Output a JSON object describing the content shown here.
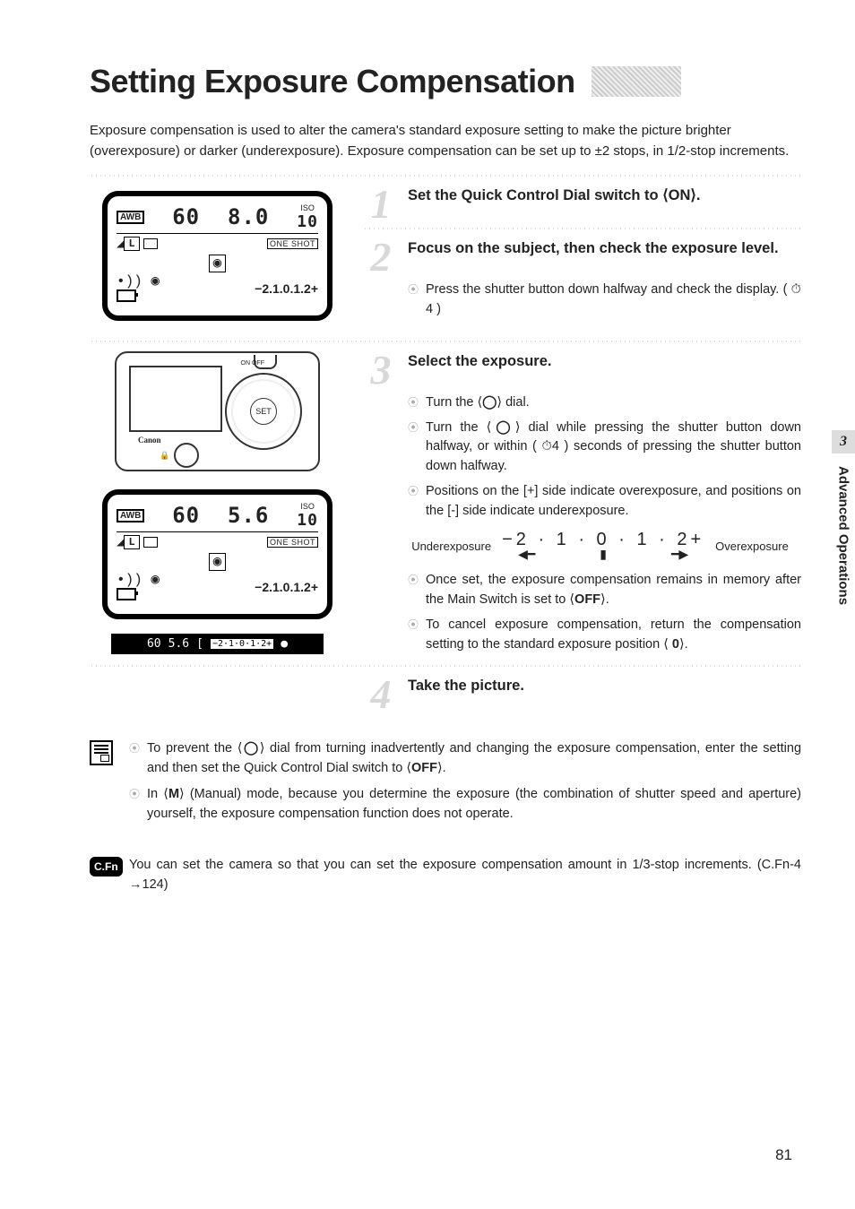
{
  "title": "Setting Exposure Compensation",
  "intro": "Exposure compensation is used to alter the camera's standard exposure setting to make the picture brighter (overexposure) or darker (underexposure). Exposure compensation can be set up to ±2 stops, in 1/2-stop increments.",
  "side_tab": {
    "num": "3",
    "label": "Advanced Operations"
  },
  "page_number": "81",
  "lcd1": {
    "awb": "AWB",
    "shutter": "60",
    "aperture": "8.0",
    "iso_lbl": "ISO",
    "iso": "10",
    "one_shot": "ONE SHOT",
    "l": "L",
    "circ": "◉",
    "scale": "−2.1.0.1.2+"
  },
  "lcd2": {
    "awb": "AWB",
    "shutter": "60",
    "aperture": "5.6",
    "iso_lbl": "ISO",
    "iso": "10",
    "one_shot": "ONE SHOT",
    "l": "L",
    "circ": "◉",
    "scale": "−2.1.0.1.2+"
  },
  "vf": {
    "shutter": "60",
    "aperture": "5.6",
    "bracket": "[",
    "scale": "−2·1·0·1·2+",
    "dot": "●"
  },
  "camera": {
    "logo": "Canon",
    "set": "SET",
    "onoff": "ON  OFF"
  },
  "steps": {
    "s1": {
      "num": "1",
      "title_a": "Set the Quick Control Dial switch to ",
      "title_b": "ON",
      "title_c": "."
    },
    "s2": {
      "num": "2",
      "title": "Focus on the subject, then check the exposure level.",
      "b1": "Press the shutter button down halfway and check the display. ( ⏱4 )"
    },
    "s3": {
      "num": "3",
      "title": "Select the exposure.",
      "b1a": "Turn the ⟨",
      "b1b": "⟩ dial.",
      "b2a": "Turn the ⟨",
      "b2b": "⟩ dial while pressing the shutter button down halfway, or within ( ⏱4 ) seconds of pressing the shutter button down halfway.",
      "b3": "Positions on the [+] side indicate overexposure, and positions on the [-] side indicate underexposure.",
      "diag_left": "Underexposure",
      "diag_scale": "−2 · 1 · 0 · 1 · 2+",
      "diag_right": "Overexposure",
      "b4a": "Once set, the exposure compensation remains in memory after the Main Switch is set to ⟨",
      "b4b": "OFF",
      "b4c": "⟩.",
      "b5a": "To cancel exposure compensation, return the compensation setting to the standard exposure position ⟨ ",
      "b5b": "⟩."
    },
    "s4": {
      "num": "4",
      "title": "Take the picture."
    }
  },
  "notes": {
    "n1a": "To prevent the ⟨",
    "n1b": "⟩ dial from turning inadvertently and changing the exposure compensation, enter the setting and then set the Quick Control Dial switch to ⟨",
    "n1c": "OFF",
    "n1d": "⟩.",
    "n2a": "In ⟨",
    "n2b": "M",
    "n2c": "⟩ (Manual) mode, because you determine the exposure (the combination of shutter speed and aperture) yourself, the exposure compensation function does not operate."
  },
  "cfn": {
    "badge": "C.Fn",
    "text": "You can set the camera so that you can set the exposure compensation amount in 1/3-stop increments. (C.Fn-4 →124)"
  }
}
